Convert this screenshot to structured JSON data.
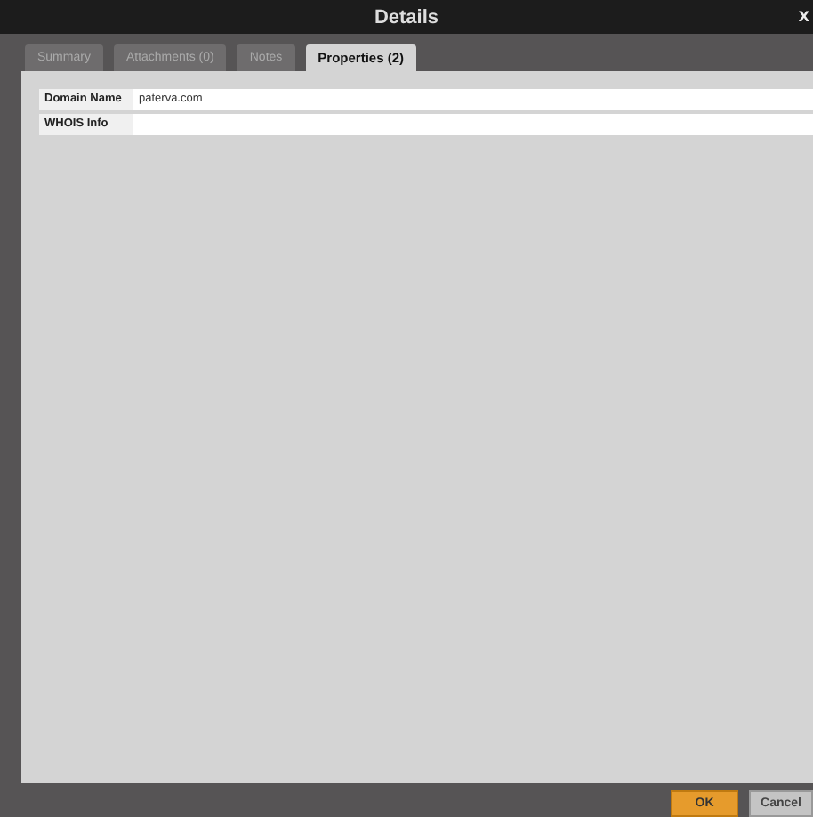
{
  "window": {
    "title": "Details",
    "close": "x"
  },
  "tabs": [
    {
      "label": "Summary",
      "selected": false
    },
    {
      "label": "Attachments (0)",
      "selected": false
    },
    {
      "label": "Notes",
      "selected": false
    },
    {
      "label": "Properties (2)",
      "selected": true
    }
  ],
  "properties": [
    {
      "name": "Domain Name",
      "value": "paterva.com"
    },
    {
      "name": "WHOIS Info"
    }
  ],
  "buttons": [
    {
      "label": "OK",
      "kind": "primary"
    },
    {
      "label": "Cancel",
      "kind": "secondary"
    }
  ]
}
